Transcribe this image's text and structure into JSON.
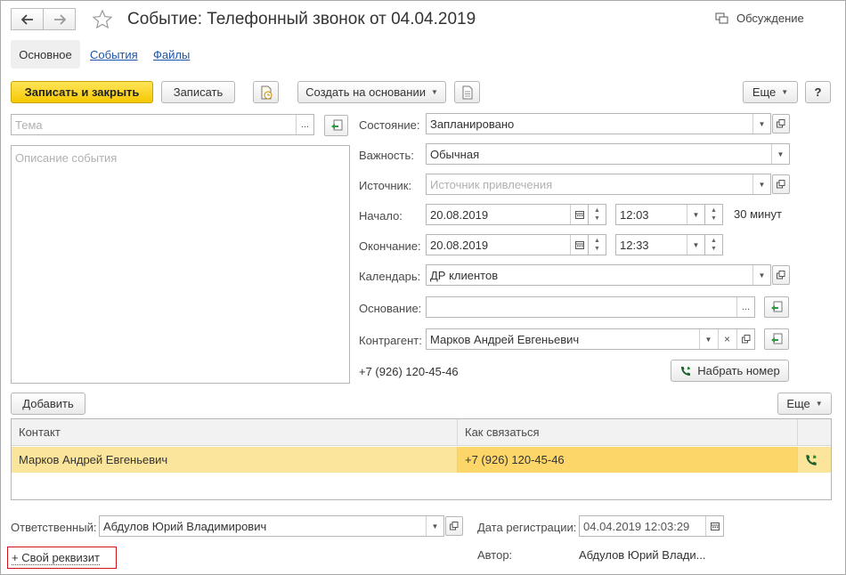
{
  "header": {
    "title": "Событие: Телефонный звонок от 04.04.2019",
    "discussion_label": "Обсуждение"
  },
  "tabs": [
    {
      "label": "Основное",
      "active": true
    },
    {
      "label": "События",
      "active": false
    },
    {
      "label": "Файлы",
      "active": false
    }
  ],
  "toolbar": {
    "save_close": "Записать и закрыть",
    "save": "Записать",
    "create_based": "Создать на основании",
    "more": "Еще",
    "help": "?"
  },
  "left": {
    "subject_placeholder": "Тема",
    "description_placeholder": "Описание события",
    "ellipsis": "..."
  },
  "form": {
    "state_label": "Состояние:",
    "state_value": "Запланировано",
    "importance_label": "Важность:",
    "importance_value": "Обычная",
    "source_label": "Источник:",
    "source_placeholder": "Источник привлечения",
    "start_label": "Начало:",
    "start_date": "20.08.2019",
    "start_time": "12:03",
    "duration": "30 минут",
    "end_label": "Окончание:",
    "end_date": "20.08.2019",
    "end_time": "12:33",
    "calendar_label": "Календарь:",
    "calendar_value": "ДР клиентов",
    "basis_label": "Основание:",
    "basis_value": "",
    "contractor_label": "Контрагент:",
    "contractor_value": "Марков Андрей Евгеньевич",
    "phone": "+7 (926) 120-45-46",
    "dial_button": "Набрать номер",
    "ellipsis": "...",
    "clear": "×"
  },
  "contacts": {
    "add_button": "Добавить",
    "more_button": "Еще",
    "columns": [
      "Контакт",
      "Как связаться"
    ],
    "rows": [
      {
        "contact": "Марков Андрей Евгеньевич",
        "how": "+7 (926) 120-45-46"
      }
    ]
  },
  "footer": {
    "responsible_label": "Ответственный:",
    "responsible_value": "Абдулов Юрий Владимирович",
    "reg_date_label": "Дата регистрации:",
    "reg_date_value": "04.04.2019 12:03:29",
    "author_label": "Автор:",
    "author_value": "Абдулов Юрий Влади...",
    "custom_attr": "+ Свой реквизит"
  },
  "colors": {
    "primary_button": "#f6c800",
    "selected_row": "#fbe59a",
    "link": "#1c55a8",
    "highlight_border": "#d0101a",
    "phone_icon": "#1a8a2e"
  }
}
